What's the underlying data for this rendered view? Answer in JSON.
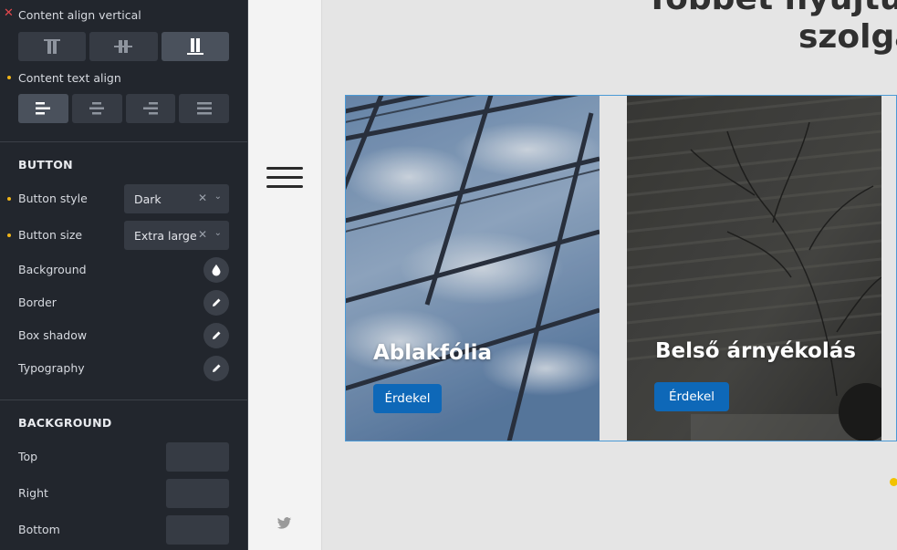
{
  "panel": {
    "content_align_vertical": "Content align vertical",
    "content_text_align": "Content text align",
    "button_section": "BUTTON",
    "button_style_label": "Button style",
    "button_style_value": "Dark",
    "button_size_label": "Button size",
    "button_size_value": "Extra large",
    "background_label": "Background",
    "border_label": "Border",
    "box_shadow_label": "Box shadow",
    "typography_label": "Typography",
    "background_section": "BACKGROUND",
    "top_label": "Top",
    "right_label": "Right",
    "bottom_label": "Bottom",
    "vertical_align_options": [
      "align-top-icon",
      "align-center-icon",
      "align-stretch-icon"
    ],
    "vertical_align_selected": 2,
    "text_align_options": [
      "text-left-icon",
      "text-center-icon",
      "text-right-icon",
      "text-justify-icon"
    ],
    "text_align_selected": 0,
    "accent_dot_color": "#f0b418",
    "reset_color": "#e5484d"
  },
  "canvas": {
    "heading_line1": "Többet nyújtunk",
    "heading_line2": "szolgá",
    "cards": [
      {
        "title": "Ablakfólia",
        "button": "Érdekel"
      },
      {
        "title": "Belső árnyékolás",
        "button": "Érdekel"
      }
    ],
    "button_color": "#0e68b8"
  }
}
